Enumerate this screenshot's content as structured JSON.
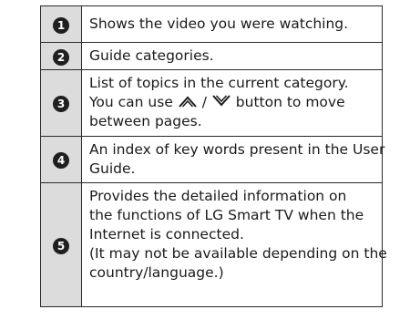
{
  "legend": {
    "rows": [
      {
        "number": "1",
        "lines": [
          "Shows the video you were watching."
        ]
      },
      {
        "number": "2",
        "lines": [
          "Guide categories."
        ]
      },
      {
        "number": "3",
        "line1": "List of topics in the current category.",
        "line2_before": "You can use ",
        "line2_separator": " / ",
        "line2_after": " button to move",
        "line3": "between pages.",
        "up_icon": "chevron-up-icon",
        "down_icon": "chevron-down-icon"
      },
      {
        "number": "4",
        "lines": [
          "An index of key words present in the User",
          "Guide."
        ]
      },
      {
        "number": "5",
        "lines": [
          "Provides the detailed information on",
          "the functions of LG Smart TV when the",
          "Internet is connected.",
          "(It may not be available depending on the",
          "country/language.)"
        ]
      }
    ]
  }
}
